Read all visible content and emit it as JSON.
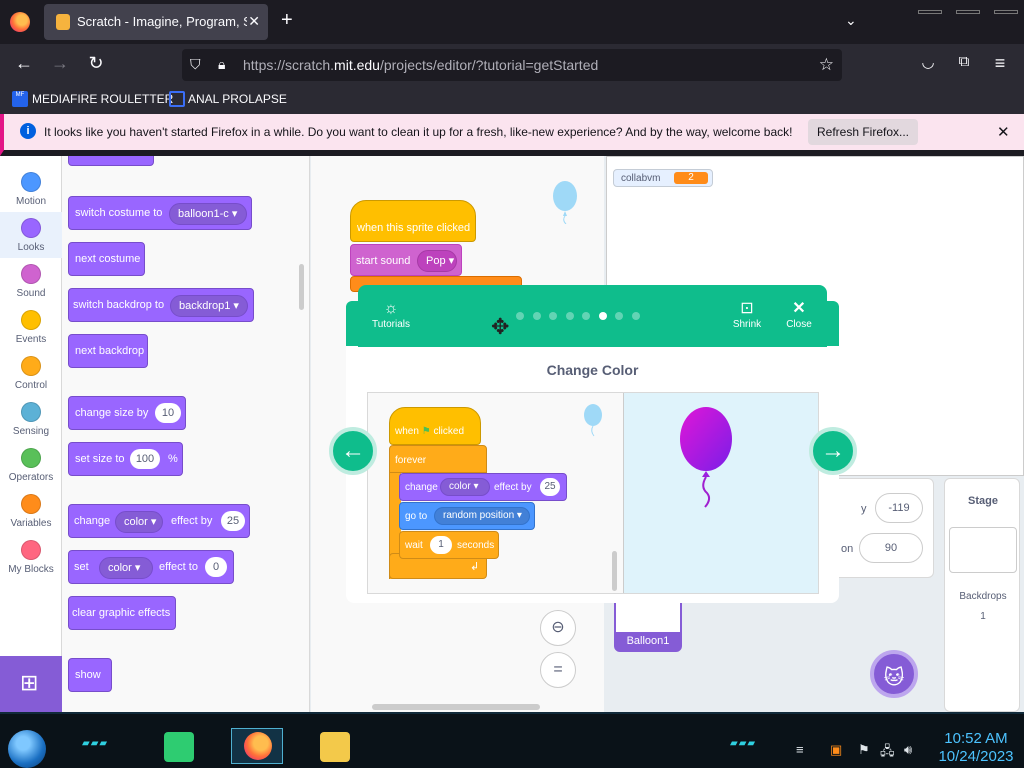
{
  "browser": {
    "tab_title": "Scratch - Imagine, Program, Sh",
    "url_prefix": "https://scratch.",
    "url_domain": "mit.edu",
    "url_rest": "/projects/editor/?tutorial=getStarted",
    "new_tab": "+",
    "bookmarks": [
      "MEDIAFIRE ROULETTER",
      "ANAL PROLAPSE"
    ],
    "notification": "It looks like you haven't started Firefox in a while. Do you want to clean it up for a fresh, like-new experience? And by the way, welcome back!",
    "notification_button": "Refresh Firefox..."
  },
  "categories": [
    {
      "label": "Motion",
      "color": "#4c97ff"
    },
    {
      "label": "Looks",
      "color": "#9966ff"
    },
    {
      "label": "Sound",
      "color": "#cf63cf"
    },
    {
      "label": "Events",
      "color": "#ffbf00"
    },
    {
      "label": "Control",
      "color": "#ffab19"
    },
    {
      "label": "Sensing",
      "color": "#5cb1d6"
    },
    {
      "label": "Operators",
      "color": "#59c059"
    },
    {
      "label": "Variables",
      "color": "#ff8c1a"
    },
    {
      "label": "My Blocks",
      "color": "#ff6680"
    }
  ],
  "palette": {
    "switch_costume": "switch costume to",
    "costume_value": "balloon1-c",
    "next_costume": "next costume",
    "switch_backdrop": "switch backdrop to",
    "backdrop_value": "backdrop1",
    "next_backdrop": "next backdrop",
    "change_size": "change size by",
    "change_size_value": "10",
    "set_size": "set size to",
    "set_size_value": "100",
    "percent": "%",
    "change": "change",
    "color": "color",
    "effect_by": "effect by",
    "effect_by_value": "25",
    "set": "set",
    "effect_to": "effect to",
    "effect_to_value": "0",
    "clear_effects": "clear graphic effects",
    "show": "show"
  },
  "script": {
    "hat": "when this sprite clicked",
    "start_sound": "start sound",
    "sound_value": "Pop"
  },
  "stage": {
    "monitor_name": "collabvm",
    "monitor_value": "2",
    "y_label": "y",
    "y_value": "-119",
    "direction_label": "on",
    "direction_value": "90",
    "sprite_name": "Balloon1",
    "stage_title": "Stage",
    "backdrops_label": "Backdrops",
    "backdrops_count": "1"
  },
  "tutorial": {
    "tutorials_label": "Tutorials",
    "shrink_label": "Shrink",
    "close_label": "Close",
    "title": "Change Color",
    "dots_total": 8,
    "dots_active": 6,
    "blocks": {
      "when": "when",
      "clicked": "clicked",
      "forever": "forever",
      "change": "change",
      "color": "color",
      "effect_by": "effect by",
      "effect_value": "25",
      "go_to": "go to",
      "random_position": "random position",
      "wait": "wait",
      "wait_value": "1",
      "seconds": "seconds"
    }
  },
  "taskbar": {
    "time": "10:52 AM",
    "date": "10/24/2023"
  }
}
